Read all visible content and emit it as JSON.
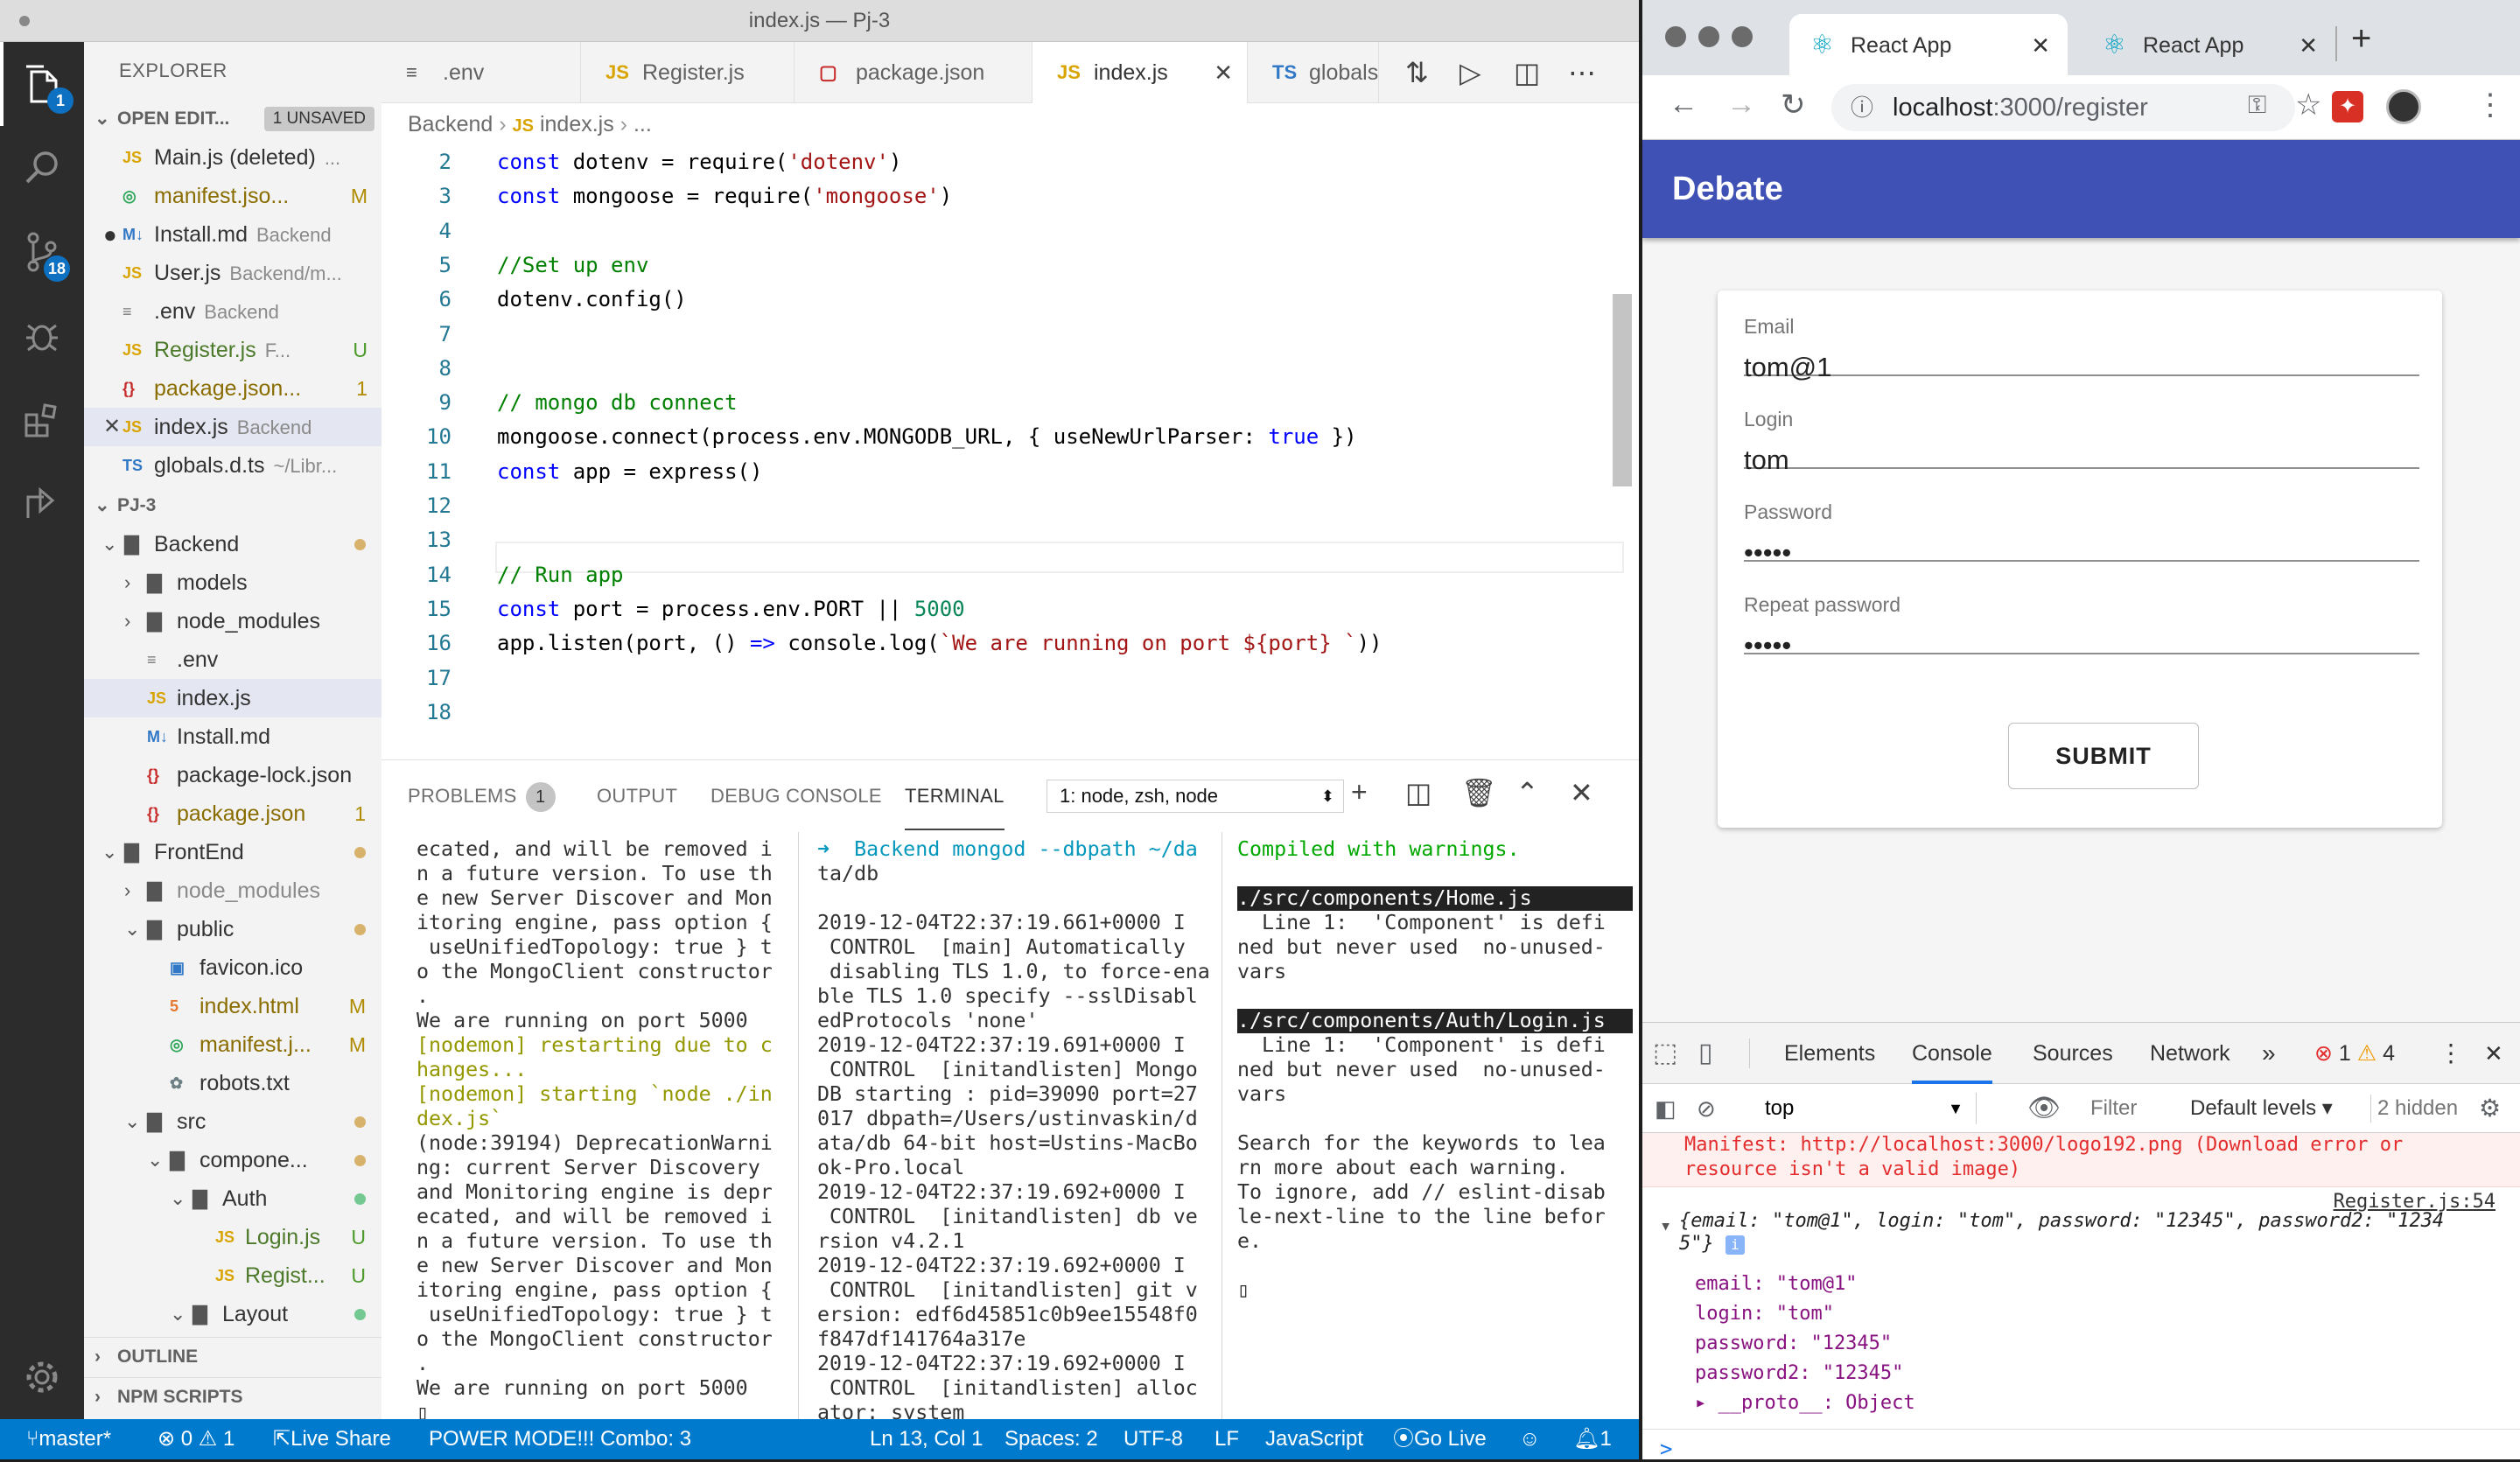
{
  "vscode": {
    "window_title": "index.js — Pj-3",
    "activity_badges": {
      "explorer": "1",
      "scm": "18"
    },
    "explorer_title": "EXPLORER",
    "open_editors": {
      "title": "OPEN EDIT...",
      "unsaved": "1 UNSAVED",
      "items": [
        {
          "icon": "JS",
          "name": "Main.js (deleted)",
          "desc": "...",
          "status": ""
        },
        {
          "icon": "◎",
          "name": "manifest.jso...",
          "desc": "",
          "status": "M"
        },
        {
          "icon": "M↓",
          "name": "Install.md",
          "desc": "Backend",
          "status": ""
        },
        {
          "icon": "JS",
          "name": "User.js",
          "desc": "Backend/m...",
          "status": ""
        },
        {
          "icon": "≡",
          "name": ".env",
          "desc": "Backend",
          "status": ""
        },
        {
          "icon": "JS",
          "name": "Register.js",
          "desc": "F...",
          "status": "U"
        },
        {
          "icon": "{}",
          "name": "package.json...",
          "desc": "",
          "status": "1"
        },
        {
          "icon": "JS",
          "name": "index.js",
          "desc": "Backend",
          "status": ""
        },
        {
          "icon": "TS",
          "name": "globals.d.ts",
          "desc": "~/Libr...",
          "status": ""
        }
      ]
    },
    "project": {
      "title": "PJ-3",
      "items": [
        {
          "name": "Backend",
          "type": "folder",
          "open": true,
          "depth": 0
        },
        {
          "name": "models",
          "type": "folder",
          "open": false,
          "depth": 1
        },
        {
          "name": "node_modules",
          "type": "folder",
          "open": false,
          "depth": 1
        },
        {
          "name": ".env",
          "type": "file",
          "icon": "≡",
          "depth": 1
        },
        {
          "name": "index.js",
          "type": "file",
          "icon": "JS",
          "depth": 1
        },
        {
          "name": "Install.md",
          "type": "file",
          "icon": "M↓",
          "depth": 1
        },
        {
          "name": "package-lock.json",
          "type": "file",
          "icon": "{}",
          "depth": 1
        },
        {
          "name": "package.json",
          "type": "file",
          "icon": "{}",
          "depth": 1,
          "status": "1"
        },
        {
          "name": "FrontEnd",
          "type": "folder",
          "open": true,
          "depth": 0
        },
        {
          "name": "node_modules",
          "type": "folder",
          "open": false,
          "depth": 1
        },
        {
          "name": "public",
          "type": "folder",
          "open": true,
          "depth": 1
        },
        {
          "name": "favicon.ico",
          "type": "file",
          "icon": "▣",
          "depth": 2
        },
        {
          "name": "index.html",
          "type": "file",
          "icon": "5",
          "depth": 2,
          "status": "M"
        },
        {
          "name": "manifest.j...",
          "type": "file",
          "icon": "◎",
          "depth": 2,
          "status": "M"
        },
        {
          "name": "robots.txt",
          "type": "file",
          "icon": "✿",
          "depth": 2
        },
        {
          "name": "src",
          "type": "folder",
          "open": true,
          "depth": 1
        },
        {
          "name": "compone...",
          "type": "folder",
          "open": true,
          "depth": 2
        },
        {
          "name": "Auth",
          "type": "folder",
          "open": true,
          "depth": 3
        },
        {
          "name": "Login.js",
          "type": "file",
          "icon": "JS",
          "depth": 4,
          "status": "U"
        },
        {
          "name": "Regist...",
          "type": "file",
          "icon": "JS",
          "depth": 4,
          "status": "U"
        },
        {
          "name": "Layout",
          "type": "folder",
          "open": true,
          "depth": 3
        }
      ]
    },
    "outline": "OUTLINE",
    "npm_scripts": "NPM SCRIPTS",
    "tabs": [
      ".env",
      "Register.js",
      "package.json",
      "index.js",
      "globals.d"
    ],
    "breadcrumb": {
      "root": "Backend",
      "file": "index.js",
      "rest": "..."
    },
    "code_lines": [
      {
        "n": "2",
        "t": "const dotenv = require('dotenv')"
      },
      {
        "n": "3",
        "t": "const mongoose = require('mongoose')"
      },
      {
        "n": "4",
        "t": ""
      },
      {
        "n": "5",
        "t": "//Set up env"
      },
      {
        "n": "6",
        "t": "dotenv.config()"
      },
      {
        "n": "7",
        "t": ""
      },
      {
        "n": "8",
        "t": ""
      },
      {
        "n": "9",
        "t": "// mongo db connect"
      },
      {
        "n": "10",
        "t": "mongoose.connect(process.env.MONGODB_URL, { useNewUrlParser: true })"
      },
      {
        "n": "11",
        "t": "const app = express()"
      },
      {
        "n": "12",
        "t": ""
      },
      {
        "n": "13",
        "t": ""
      },
      {
        "n": "14",
        "t": "// Run app"
      },
      {
        "n": "15",
        "t": "const port = process.env.PORT || 5000"
      },
      {
        "n": "16",
        "t": "app.listen(port, () => console.log(`We are running on port ${port} `))"
      },
      {
        "n": "17",
        "t": ""
      },
      {
        "n": "18",
        "t": ""
      }
    ],
    "panel": {
      "tabs": [
        "PROBLEMS",
        "OUTPUT",
        "DEBUG CONSOLE",
        "TERMINAL"
      ],
      "problems_count": "1",
      "terminal_select": "1: node, zsh, node"
    },
    "term1": [
      "ecated, and will be removed i",
      "n a future version. To use th",
      "e new Server Discover and Mon",
      "itoring engine, pass option {",
      " useUnifiedTopology: true } t",
      "o the MongoClient constructor",
      ".",
      "We are running on port 5000",
      "[nodemon] restarting due to c",
      "hanges...",
      "[nodemon] starting `node ./in",
      "dex.js`",
      "(node:39194) DeprecationWarni",
      "ng: current Server Discovery",
      "and Monitoring engine is depr",
      "ecated, and will be removed i",
      "n a future version. To use th",
      "e new Server Discover and Mon",
      "itoring engine, pass option {",
      " useUnifiedTopology: true } t",
      "o the MongoClient constructor",
      ".",
      "We are running on port 5000",
      "▯"
    ],
    "term2": [
      "➜  Backend mongod --dbpath ~/da",
      "ta/db",
      "",
      "2019-12-04T22:37:19.661+0000 I",
      " CONTROL  [main] Automatically",
      " disabling TLS 1.0, to force-ena",
      "ble TLS 1.0 specify --sslDisabl",
      "edProtocols 'none'",
      "2019-12-04T22:37:19.691+0000 I",
      " CONTROL  [initandlisten] Mongo",
      "DB starting : pid=39090 port=27",
      "017 dbpath=/Users/ustinvaskin/d",
      "ata/db 64-bit host=Ustins-MacBo",
      "ok-Pro.local",
      "2019-12-04T22:37:19.692+0000 I",
      " CONTROL  [initandlisten] db ve",
      "rsion v4.2.1",
      "2019-12-04T22:37:19.692+0000 I",
      " CONTROL  [initandlisten] git v",
      "ersion: edf6d45851c0b9ee15548f0",
      "f847df141764a317e",
      "2019-12-04T22:37:19.692+0000 I",
      " CONTROL  [initandlisten] alloc",
      "ator: system"
    ],
    "term3": [
      "Compiled with warnings.",
      "",
      "./src/components/Home.js",
      "  Line 1:  'Component' is defi",
      "ned but never used  no-unused-",
      "vars",
      "",
      "./src/components/Auth/Login.js",
      "  Line 1:  'Component' is defi",
      "ned but never used  no-unused-",
      "vars",
      "",
      "Search for the keywords to lea",
      "rn more about each warning.",
      "To ignore, add // eslint-disab",
      "le-next-line to the line befor",
      "e.",
      "",
      "▯"
    ],
    "status": {
      "branch": "master*",
      "errors": "⊗ 0 ⚠ 1",
      "live_share": "Live Share",
      "power": "POWER MODE!!! Combo: 3",
      "cursor": "Ln 13, Col 1",
      "spaces": "Spaces: 2",
      "encoding": "UTF-8",
      "eol": "LF",
      "language": "JavaScript",
      "go_live": "Go Live",
      "bell": "1"
    }
  },
  "browser": {
    "tabs": [
      "React App",
      "React App"
    ],
    "url_host": "localhost",
    "url_path": ":3000/register",
    "app_title": "Debate",
    "form": [
      {
        "label": "Email",
        "value": "tom@1"
      },
      {
        "label": "Login",
        "value": "tom"
      },
      {
        "label": "Password",
        "value": "•••••"
      },
      {
        "label": "Repeat password",
        "value": "•••••"
      }
    ],
    "submit": "SUBMIT",
    "devtools": {
      "tabs": [
        "Elements",
        "Console",
        "Sources",
        "Network"
      ],
      "errors": "1",
      "warnings": "4",
      "context": "top",
      "filter_placeholder": "Filter",
      "levels": "Default levels ▾",
      "hidden": "2 hidden",
      "error_line1": "Manifest: http://localhost:3000/logo192.png (Download error or",
      "error_line2": "resource isn't a valid image)",
      "source": "Register.js:54",
      "obj_line1": "{email: \"tom@1\", login: \"tom\", password: \"12345\", password2: \"1234",
      "obj_line2": "5\"}",
      "props": [
        "email: \"tom@1\"",
        "login: \"tom\"",
        "password: \"12345\"",
        "password2: \"12345\"",
        "▸ __proto__: Object"
      ],
      "prompt": ">"
    }
  }
}
